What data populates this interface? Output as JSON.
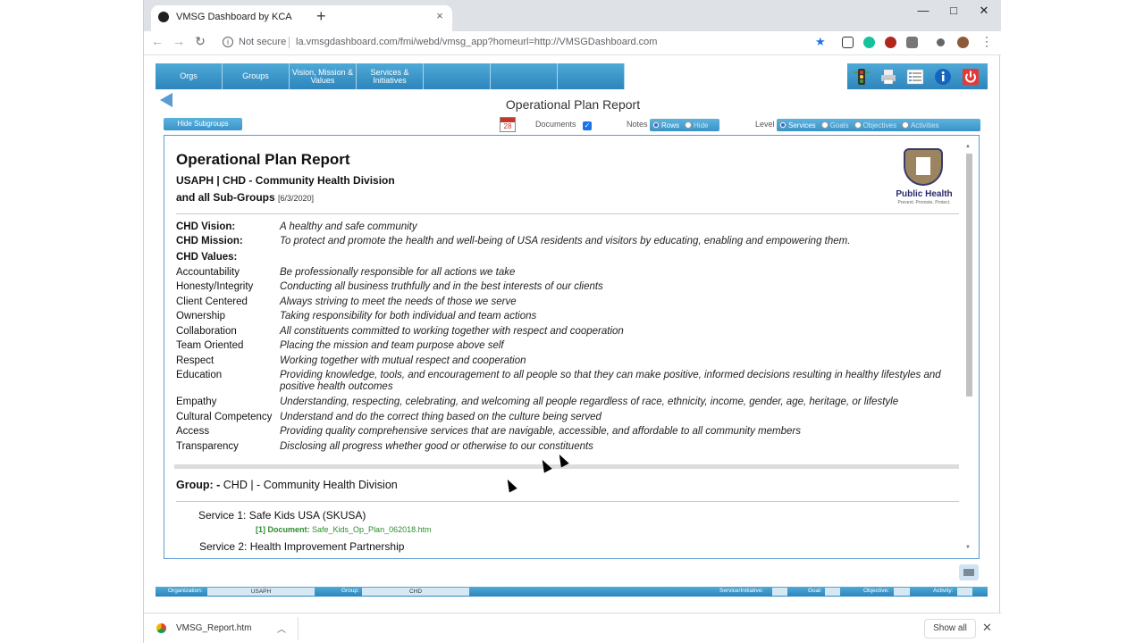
{
  "browser": {
    "tab_title": "VMSG Dashboard by KCA",
    "new_tab": "+",
    "tab_close": "×",
    "win_min": "—",
    "win_max": "□",
    "win_close": "✕",
    "security_label": "Not secure",
    "url": "la.vmsgdashboard.com/fmi/webd/vmsg_app?homeurl=http://VMSGDashboard.com"
  },
  "nav": {
    "tabs": [
      {
        "label": "Orgs"
      },
      {
        "label": "Groups"
      },
      {
        "label": "Vision, Mission & Values"
      },
      {
        "label": "Services & Initiatives"
      },
      {
        "label": ""
      },
      {
        "label": ""
      },
      {
        "label": ""
      }
    ]
  },
  "page": {
    "title": "Operational Plan Report"
  },
  "controls": {
    "hide_subgroups": "Hide Subgroups",
    "calendar_day": "28",
    "documents_label": "Documents",
    "notes_label": "Notes",
    "notes_options": [
      "Rows",
      "Hide"
    ],
    "level_label": "Level",
    "level_options": [
      "Services",
      "Goals",
      "Objectives",
      "Activities"
    ]
  },
  "report": {
    "title": "Operational Plan Report",
    "org_line": "USAPH | CHD - Community Health Division",
    "sub_line": "and all Sub-Groups",
    "date": "[6/3/2020]",
    "logo_name": "Public Health",
    "logo_tagline": "Prevent. Promote. Protect.",
    "vision_label": "CHD Vision:",
    "vision": "A healthy and safe community",
    "mission_label": "CHD Mission:",
    "mission": "To protect and promote the health and well-being of USA residents and visitors by educating, enabling and empowering them.",
    "values_label": "CHD Values:",
    "values": [
      {
        "name": "Accountability",
        "desc": "Be professionally responsible for all actions we take"
      },
      {
        "name": "Honesty/Integrity",
        "desc": "Conducting all business truthfully and in the best interests of our clients"
      },
      {
        "name": "Client Centered",
        "desc": "Always striving to meet the needs of those we serve"
      },
      {
        "name": "Ownership",
        "desc": "Taking responsibility for both individual and team actions"
      },
      {
        "name": "Collaboration",
        "desc": "All constituents committed to working together with respect and cooperation"
      },
      {
        "name": "Team Oriented",
        "desc": "Placing the mission and team purpose above self"
      },
      {
        "name": "Respect",
        "desc": "Working together with mutual respect and cooperation"
      },
      {
        "name": "Education",
        "desc": "Providing knowledge, tools, and encouragement to all people so that they can make positive, informed decisions resulting in healthy lifestyles and positive health outcomes"
      },
      {
        "name": "Empathy",
        "desc": "Understanding, respecting, celebrating, and welcoming all people regardless of race, ethnicity, income, gender, age, heritage, or lifestyle"
      },
      {
        "name": "Cultural Competency",
        "desc": "Understand and do the correct thing based on the culture being served"
      },
      {
        "name": "Access",
        "desc": "Providing quality comprehensive services that are navigable, accessible, and affordable to all community members"
      },
      {
        "name": "Transparency",
        "desc": "Disclosing all progress whether good or otherwise to our constituents"
      }
    ],
    "group_label": "Group: -",
    "group_name": "CHD | - Community Health Division",
    "services": [
      {
        "label": "Service 1: Safe Kids USA (SKUSA)"
      },
      {
        "label": "Service 2: Health Improvement Partnership"
      }
    ],
    "document_prefix": "[1] Document:",
    "document_file": "Safe_Kids_Op_Plan_062018.htm"
  },
  "statusbar": {
    "org_label": "Organization:",
    "org_value": "USAPH",
    "group_label": "Group:",
    "group_value": "CHD",
    "service_label": "Service/Initiative:",
    "goal_label": "Goal:",
    "objective_label": "Objective:",
    "activity_label": "Activity:"
  },
  "downloads": {
    "file": "VMSG_Report.htm",
    "show_all": "Show all"
  }
}
